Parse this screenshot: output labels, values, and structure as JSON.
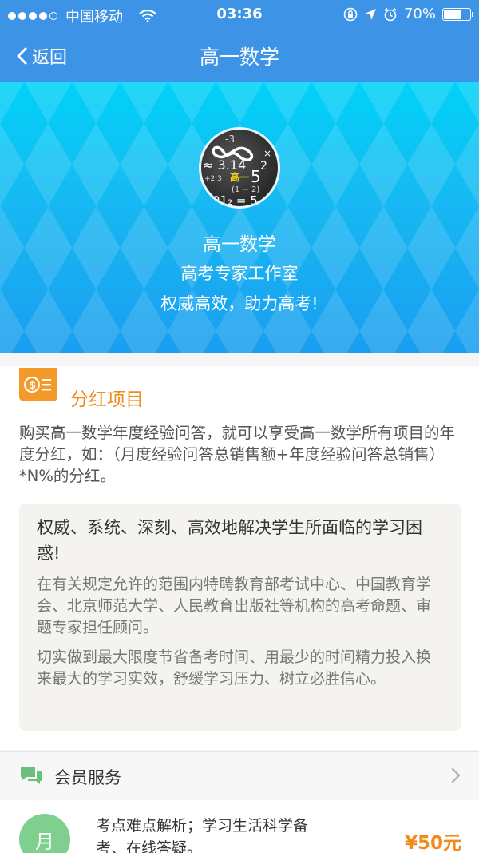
{
  "status": {
    "carrier": "中国移动",
    "time": "03:36",
    "battery": "70%",
    "battery_level": 0.7
  },
  "nav": {
    "back_label": "返回",
    "title": "高一数学"
  },
  "hero": {
    "name": "高一数学",
    "org": "高考专家工作室",
    "slogan": "权威高效，助力高考!",
    "avatar_overlay": "高一"
  },
  "bonus": {
    "title": "分红项目",
    "description": "购买高一数学年度经验问答，就可以享受高一数学所有项目的年度分红，如：（月度经验问答总销售额+年度经验问答总销售）*N%的分红。"
  },
  "quote": {
    "heading": "权威、系统、深刻、高效地解决学生所面临的学习困惑!",
    "paragraphs": [
      "在有关规定允许的范围内特聘教育部考试中心、中国教育学会、北京师范大学、人民教育出版社等机构的高考命题、审题专家担任顾问。",
      "切实做到最大限度节省备考时间、用最少的时间精力投入换来最大的学习实效，舒缓学习压力、树立必胜信心。"
    ]
  },
  "service": {
    "label": "会员服务"
  },
  "plan": {
    "badge": "月",
    "description": "考点难点解析；学习生活科学备考、在线答疑。",
    "price": "¥50元"
  },
  "colors": {
    "nav_blue": "#3d94e6",
    "accent_orange": "#f18b1c",
    "badge_green": "#7fcf8f"
  }
}
